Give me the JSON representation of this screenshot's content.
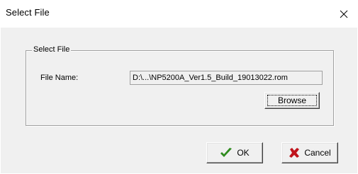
{
  "window": {
    "title": "Select File"
  },
  "group": {
    "legend": "Select File",
    "file_name_label": "File Name:",
    "file_name_value": "D:\\...\\NP5200A_Ver1.5_Build_19013022.rom",
    "browse_label": "Browse"
  },
  "buttons": {
    "ok_label": "OK",
    "cancel_label": "Cancel"
  },
  "icons": {
    "close": "close-icon",
    "ok": "checkmark-icon",
    "cancel": "x-mark-icon"
  },
  "colors": {
    "ok_icon": "#2e8b1e",
    "cancel_icon": "#c0141c"
  }
}
